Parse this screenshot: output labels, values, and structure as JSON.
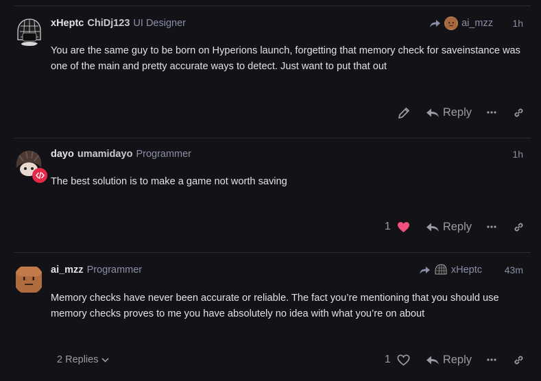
{
  "posts": [
    {
      "username": "xHeptc",
      "fullname": "ChiDj123",
      "title": "UI Designer",
      "reply_to": "ai_mzz",
      "time": "1h",
      "body": "You are the same guy to be born on Hyperions launch, forgetting that memory check for saveinstance was one of the main and pretty accurate ways to detect. Just want to put that out",
      "reply_label": "Reply"
    },
    {
      "username": "dayo",
      "fullname": "umamidayo",
      "title": "Programmer",
      "time": "1h",
      "body": "The best solution is to make a game not worth saving",
      "like_count": "1",
      "reply_label": "Reply"
    },
    {
      "username": "ai_mzz",
      "title": "Programmer",
      "reply_to": "xHeptc",
      "time": "43m",
      "body": "Memory checks have never been accurate or reliable. The fact you’re mentioning that you should use memory checks proves to me you have absolutely no idea with what you’re on about",
      "like_count": "1",
      "replies_label": "2 Replies",
      "reply_label": "Reply"
    }
  ],
  "colors": {
    "background": "#121217",
    "accent_like": "#f0507a",
    "badge": "#e8284a",
    "muted": "#8b8fa8"
  },
  "icons": [
    "share-arrow-icon",
    "pencil-icon",
    "reply-arrow-icon",
    "more-icon",
    "link-icon",
    "heart-icon",
    "chevron-down-icon",
    "code-badge-icon"
  ]
}
